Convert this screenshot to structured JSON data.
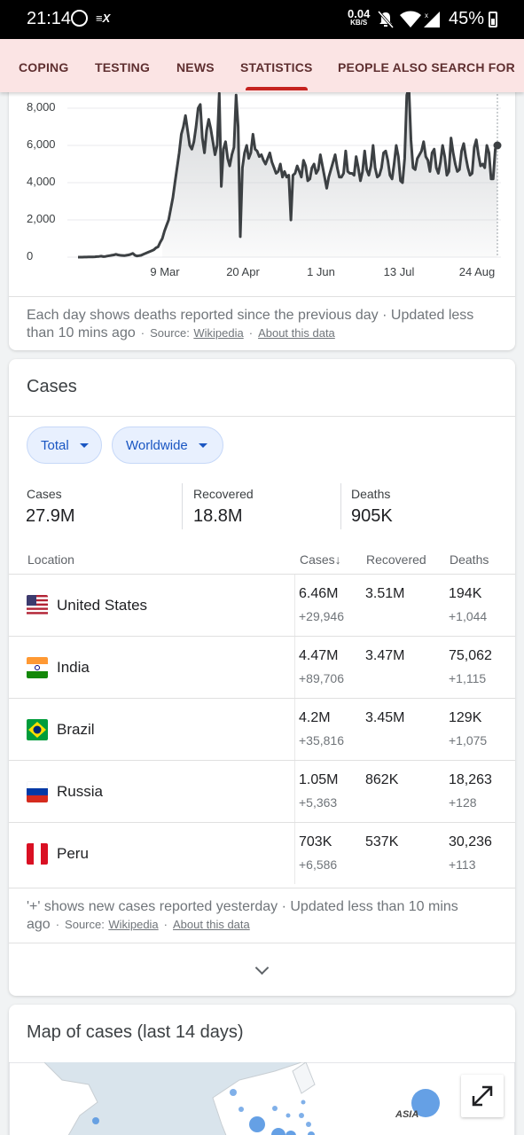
{
  "status_bar": {
    "time": "21:14",
    "nfc_label": "≡X",
    "net_speed": "0.04",
    "net_speed_unit": "KB/S",
    "battery": "45%"
  },
  "tabs": [
    {
      "label": "COPING"
    },
    {
      "label": "TESTING"
    },
    {
      "label": "NEWS"
    },
    {
      "label": "STATISTICS",
      "active": true
    },
    {
      "label": "PEOPLE ALSO SEARCH FOR"
    }
  ],
  "deaths_chart": {
    "chart_data": {
      "type": "line",
      "y_ticks": [
        "8,000",
        "6,000",
        "4,000",
        "2,000",
        "0"
      ],
      "x_ticks": [
        "9 Mar",
        "20 Apr",
        "1 Jun",
        "13 Jul",
        "24 Aug"
      ],
      "ylim": [
        0,
        8000
      ],
      "line_color": "#3c4043",
      "fill": "gradient-grey",
      "values": [
        0,
        0,
        0,
        5,
        5,
        10,
        10,
        15,
        20,
        30,
        40,
        50,
        30,
        40,
        60,
        80,
        100,
        120,
        150,
        120,
        100,
        90,
        80,
        100,
        120,
        150,
        200,
        100,
        60,
        80,
        100,
        150,
        200,
        250,
        300,
        350,
        400,
        500,
        550,
        800,
        1000,
        1400,
        1700,
        2000,
        2600,
        3200,
        4000,
        4800,
        5600,
        6600,
        7000,
        7600,
        6800,
        6000,
        5800,
        6200,
        7000,
        8000,
        8200,
        6400,
        5600,
        6800,
        7400,
        6900,
        6200,
        5500,
        6000,
        8800,
        3800,
        5800,
        6200,
        5300,
        4900,
        5500,
        5900,
        8700,
        7000,
        1100,
        4800,
        5600,
        6000,
        5300,
        5600,
        6600,
        5800,
        5700,
        5400,
        5500,
        5200,
        5000,
        5300,
        5600,
        5100,
        4800,
        4500,
        4600,
        5000,
        4300,
        4600,
        4300,
        4400,
        2000,
        4400,
        4500,
        4900,
        4600,
        4300,
        5200,
        4900,
        4100,
        4200,
        4800,
        5000,
        4500,
        4700,
        5500,
        4900,
        4300,
        3700,
        4300,
        4700,
        5100,
        5500,
        4800,
        4300,
        4300,
        4500,
        5700,
        4600,
        4500,
        4500,
        4400,
        5400,
        4800,
        4100,
        4600,
        5700,
        4700,
        4400,
        4900,
        6000,
        4800,
        4300,
        4400,
        4800,
        5600,
        5700,
        5200,
        4400,
        4200,
        5000,
        6000,
        5400,
        4100,
        4000,
        5300,
        8700,
        9100,
        6300,
        4800,
        4700,
        5300,
        5500,
        5700,
        6200,
        5400,
        5200,
        4600,
        5600,
        5800,
        4800,
        4500,
        5100,
        6000,
        5400,
        4400,
        4600,
        6400,
        5600,
        5000,
        4600,
        4700,
        5700,
        6100,
        5400,
        4800,
        4400,
        4500,
        5900,
        6300,
        5500,
        4900,
        5000,
        4800,
        6000,
        5600,
        4200,
        4200,
        5800,
        6000
      ]
    },
    "note": "Each day shows deaths reported since the previous day · Updated less than 10 mins ago",
    "source_label": "Source:",
    "source_link": "Wikipedia",
    "about_link": "About this data"
  },
  "cases_card": {
    "title": "Cases",
    "filters": [
      "Total",
      "Worldwide"
    ],
    "summary": [
      {
        "label": "Cases",
        "value": "27.9M"
      },
      {
        "label": "Recovered",
        "value": "18.8M"
      },
      {
        "label": "Deaths",
        "value": "905K"
      }
    ],
    "table": {
      "headers": {
        "location": "Location",
        "cases": "Cases",
        "sort_arrow": "↓",
        "recovered": "Recovered",
        "deaths": "Deaths"
      },
      "rows": [
        {
          "country": "United States",
          "cases": "6.46M",
          "cases_new": "+29,946",
          "recovered": "3.51M",
          "deaths": "194K",
          "deaths_new": "+1,044"
        },
        {
          "country": "India",
          "cases": "4.47M",
          "cases_new": "+89,706",
          "recovered": "3.47M",
          "deaths": "75,062",
          "deaths_new": "+1,115"
        },
        {
          "country": "Brazil",
          "cases": "4.2M",
          "cases_new": "+35,816",
          "recovered": "3.45M",
          "deaths": "129K",
          "deaths_new": "+1,075"
        },
        {
          "country": "Russia",
          "cases": "1.05M",
          "cases_new": "+5,363",
          "recovered": "862K",
          "deaths": "18,263",
          "deaths_new": "+128"
        },
        {
          "country": "Peru",
          "cases": "703K",
          "cases_new": "+6,586",
          "recovered": "537K",
          "deaths": "30,236",
          "deaths_new": "+113"
        }
      ]
    },
    "note": "'+' shows new cases reported yesterday · Updated less than 10 mins ago",
    "source_label": "Source:",
    "source_link": "Wikipedia",
    "about_link": "About this data"
  },
  "map_card": {
    "title": "Map of cases (last 14 days)",
    "region_label": "ASIA"
  }
}
